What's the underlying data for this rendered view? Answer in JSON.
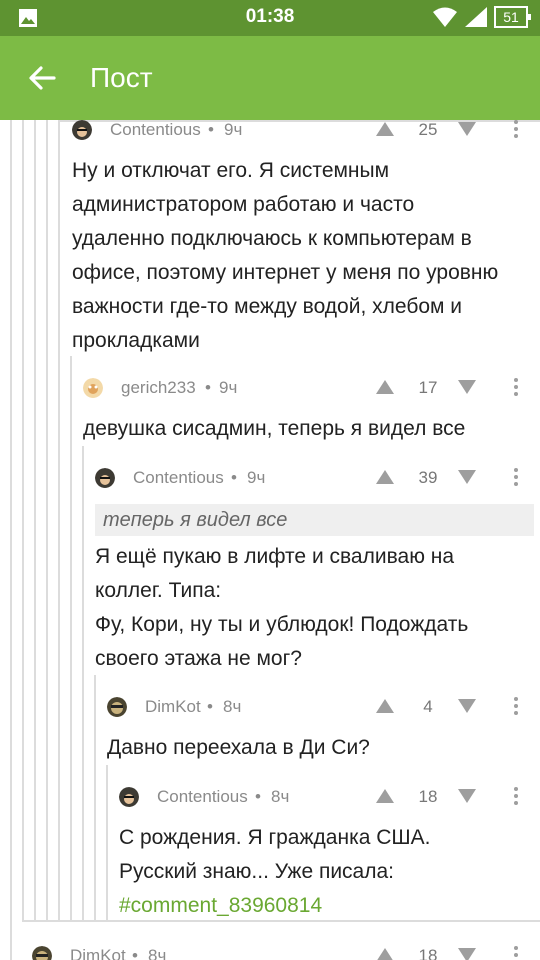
{
  "status_bar": {
    "time": "01:38",
    "battery": "51"
  },
  "app_bar": {
    "title": "Пост"
  },
  "comments": [
    {
      "author": "Contentious",
      "sep": "•",
      "time": "9ч",
      "rating": "25",
      "lines": [
        "Ну и отключат его. Я системным",
        "администратором работаю и часто",
        "удаленно подключаюсь к компьютерам в",
        "офисе, поэтому интернет у меня по уровню",
        "важности где-то между водой, хлебом и",
        "прокладками"
      ]
    },
    {
      "author": "gerich233",
      "sep": "•",
      "time": "9ч",
      "rating": "17",
      "lines": [
        "девушка сисадмин, теперь я видел все"
      ]
    },
    {
      "author": "Contentious",
      "sep": "•",
      "time": "9ч",
      "rating": "39",
      "quote": "теперь я видел все",
      "lines": [
        "Я ещё пукаю в лифте и сваливаю на",
        "коллег. Типа:",
        "Фу, Кори, ну ты и ублюдок! Подождать",
        "своего этажа не мог?"
      ]
    },
    {
      "author": "DimKot",
      "sep": "•",
      "time": "8ч",
      "rating": "4",
      "lines": [
        "Давно переехала в Ди Си?"
      ]
    },
    {
      "author": "Contentious",
      "sep": "•",
      "time": "8ч",
      "rating": "18",
      "lines": [
        "С рождения. Я гражданка США.",
        "Русский знаю... Уже писала:"
      ],
      "link": "#comment_83960814"
    },
    {
      "author": "DimKot",
      "sep": "•",
      "time": "8ч",
      "rating": "18"
    }
  ],
  "colors": {
    "status_bar": "#5e9331",
    "app_bar": "#7dbb45",
    "link": "#6aa832"
  },
  "icons": [
    "image-icon",
    "wifi-icon",
    "signal-icon",
    "battery-icon",
    "back-arrow-icon",
    "upvote-icon",
    "downvote-icon",
    "more-vert-icon"
  ]
}
